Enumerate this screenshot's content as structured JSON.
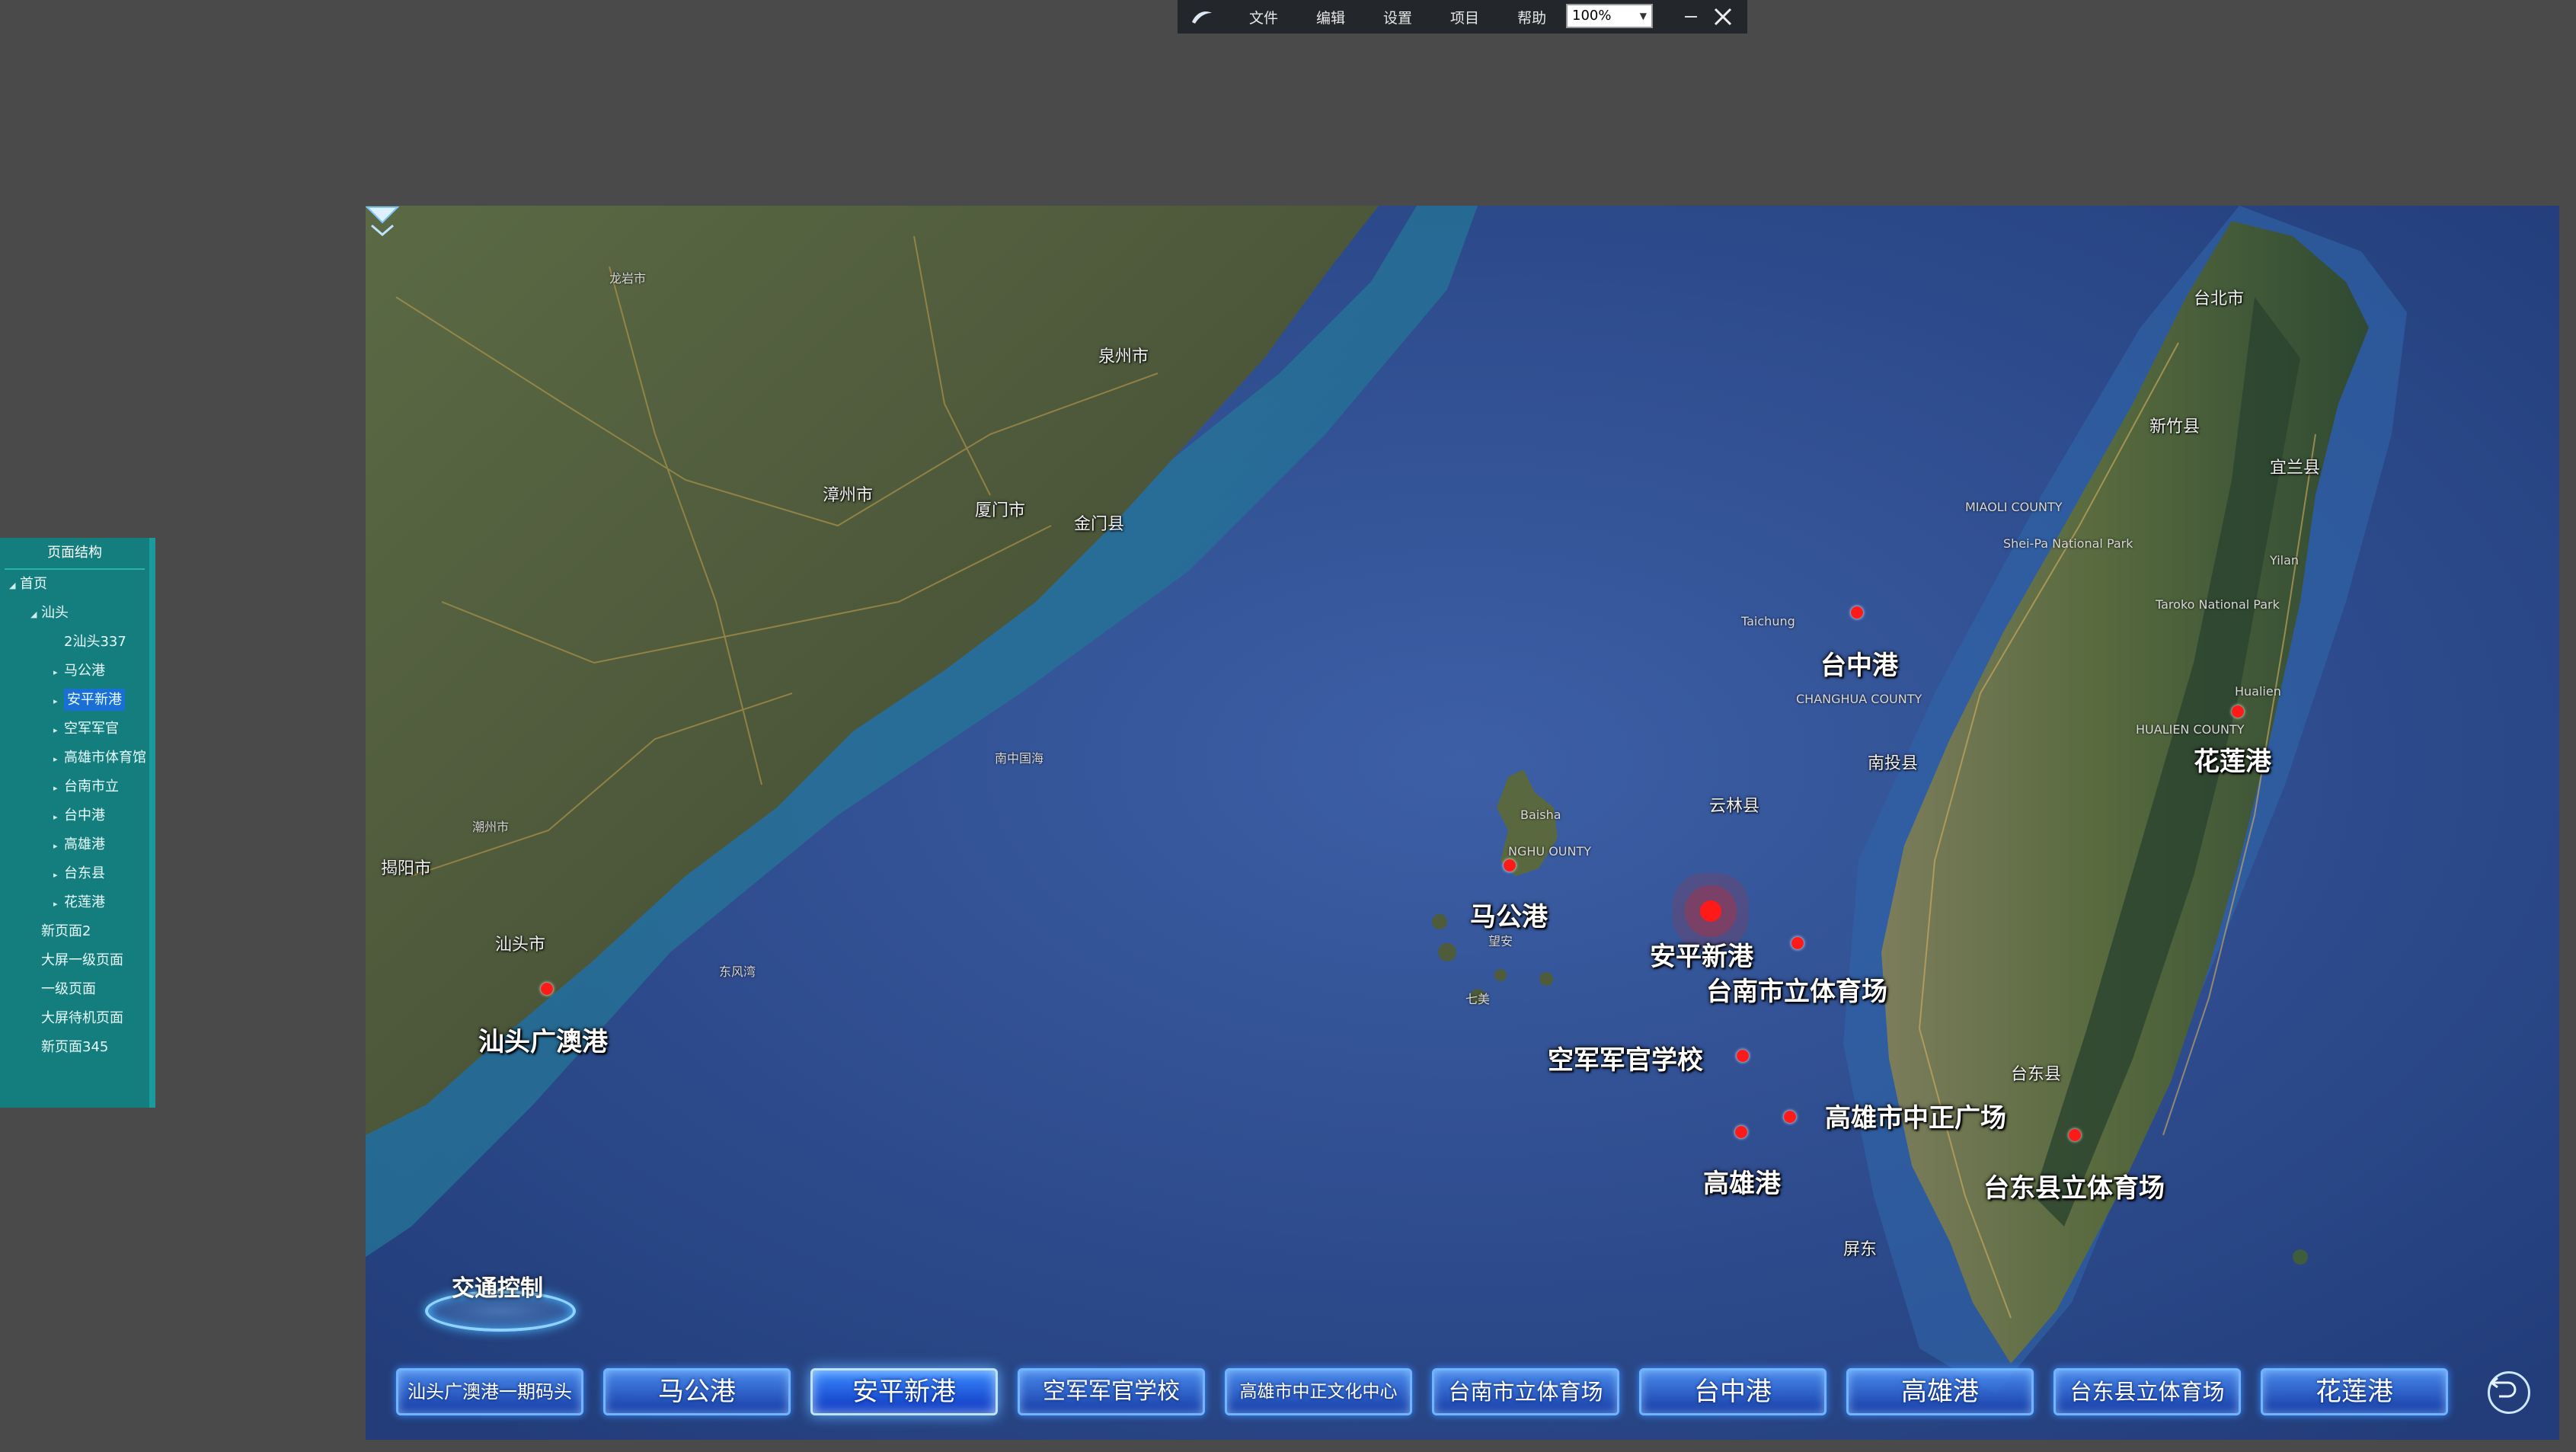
{
  "toolbar": {
    "menu": [
      "文件",
      "编辑",
      "设置",
      "项目",
      "帮助"
    ],
    "zoom": "100%"
  },
  "tree": {
    "title": "页面结构",
    "items": [
      {
        "label": "首页",
        "level": 0,
        "expander": "expanded"
      },
      {
        "label": "汕头",
        "level": 1,
        "expander": "expanded"
      },
      {
        "label": "2汕头337",
        "level": 2,
        "expander": "none"
      },
      {
        "label": "马公港",
        "level": 2,
        "expander": "collapsed"
      },
      {
        "label": "安平新港",
        "level": 2,
        "expander": "collapsed",
        "selected": true
      },
      {
        "label": "空军军官",
        "level": 2,
        "expander": "collapsed"
      },
      {
        "label": "高雄市体育馆",
        "level": 2,
        "expander": "collapsed"
      },
      {
        "label": "台南市立",
        "level": 2,
        "expander": "collapsed"
      },
      {
        "label": "台中港",
        "level": 2,
        "expander": "collapsed"
      },
      {
        "label": "高雄港",
        "level": 2,
        "expander": "collapsed"
      },
      {
        "label": "台东县",
        "level": 2,
        "expander": "collapsed"
      },
      {
        "label": "花莲港",
        "level": 2,
        "expander": "collapsed"
      },
      {
        "label": "新页面2",
        "level": 1,
        "expander": "none"
      },
      {
        "label": "大屏一级页面",
        "level": 1,
        "expander": "none"
      },
      {
        "label": "一级页面",
        "level": 1,
        "expander": "none"
      },
      {
        "label": "大屏待机页面",
        "level": 1,
        "expander": "none"
      },
      {
        "label": "新页面345",
        "level": 1,
        "expander": "none"
      }
    ]
  },
  "map": {
    "port_labels": [
      "马公港",
      "安平新港",
      "台南市立体育场",
      "空军军官学校",
      "高雄市中正广场",
      "高雄港",
      "台东县立体育场",
      "汕头广澳港",
      "台中港",
      "花莲港"
    ],
    "city_labels": [
      "泉州市",
      "漳州市",
      "厦门市",
      "金门县",
      "揭阳市",
      "汕头市",
      "台北市",
      "新竹县",
      "宜兰县",
      "云林县",
      "南投县",
      "台东县",
      "屏东"
    ],
    "place_labels": [
      "龙岩市",
      "潮州市",
      "南中国海",
      "东风湾",
      "Taichung",
      "MIAOLI COUNTY",
      "CHANGHUA COUNTY",
      "HUALIEN COUNTY",
      "Baisha",
      "NGHU OUNTY",
      "望安",
      "七美",
      "Shei-Pa National Park",
      "Taroko National Park",
      "Yilan",
      "Hualien"
    ],
    "traffic_control": "交通控制",
    "colors": {
      "sea": "#2d4c8e",
      "land": "#4f5a3c",
      "marker": "#ff1a1a"
    }
  },
  "nav": {
    "buttons": [
      "汕头广澳港一期码头",
      "马公港",
      "安平新港",
      "空军军官学校",
      "高雄市中正文化中心",
      "台南市立体育场",
      "台中港",
      "高雄港",
      "台东县立体育场",
      "花莲港"
    ],
    "active": "安平新港",
    "back_icon": "back-arrow-icon"
  }
}
